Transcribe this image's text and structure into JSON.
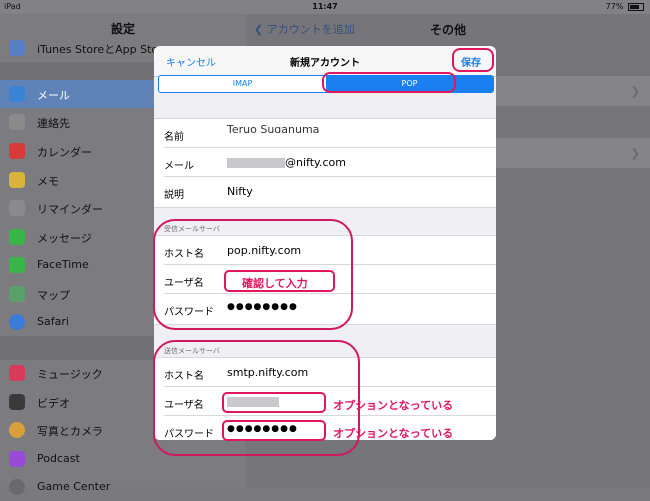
{
  "status_bar": {
    "device": "iPad",
    "time": "11:47",
    "battery": "77%"
  },
  "sidebar": {
    "title": "設定",
    "items_top": [
      {
        "label": "iTunes StoreとApp Store",
        "icon": "itunes-icon",
        "color": "#5a7ec6"
      },
      {
        "label": "メール",
        "icon": "mail-icon",
        "color": "#3a84d8",
        "selected": true
      },
      {
        "label": "連絡先",
        "icon": "contacts-icon",
        "color": "#8a8a8a"
      },
      {
        "label": "カレンダー",
        "icon": "calendar-icon",
        "color": "#d83a3a"
      },
      {
        "label": "メモ",
        "icon": "notes-icon",
        "color": "#d8b53a"
      },
      {
        "label": "リマインダー",
        "icon": "reminders-icon",
        "color": "#8a8a8a"
      },
      {
        "label": "メッセージ",
        "icon": "messages-icon",
        "color": "#3ab54a"
      },
      {
        "label": "FaceTime",
        "icon": "facetime-icon",
        "color": "#3ab54a"
      },
      {
        "label": "マップ",
        "icon": "maps-icon",
        "color": "#5aa06a"
      },
      {
        "label": "Safari",
        "icon": "safari-icon",
        "color": "#3a7ad8"
      }
    ],
    "items_bottom": [
      {
        "label": "ミュージック",
        "icon": "music-icon",
        "color": "#d83a5a"
      },
      {
        "label": "ビデオ",
        "icon": "videos-icon",
        "color": "#3a3a3a"
      },
      {
        "label": "写真とカメラ",
        "icon": "photos-icon",
        "color": "#d8a03a"
      },
      {
        "label": "Podcast",
        "icon": "podcast-icon",
        "color": "#9a4ad8"
      },
      {
        "label": "Game Center",
        "icon": "game-center-icon",
        "color": "#6a6a6a"
      }
    ]
  },
  "detail": {
    "back_label": "アカウントを追加",
    "title": "その他"
  },
  "modal": {
    "cancel_label": "キャンセル",
    "title": "新規アカウント",
    "save_label": "保存",
    "segments": [
      "IMAP",
      "POP"
    ],
    "account_rows": [
      {
        "key": "名前",
        "value": "Teruo Suganuma"
      },
      {
        "key": "メール",
        "value": "@nifty.com"
      },
      {
        "key": "説明",
        "value": "Nifty"
      }
    ],
    "incoming_header": "受信メールサーバ",
    "incoming_rows": [
      {
        "key": "ホスト名",
        "value": "pop.nifty.com"
      },
      {
        "key": "ユーザ名",
        "value": ""
      },
      {
        "key": "パスワード",
        "value": "●●●●●●●●"
      }
    ],
    "outgoing_header": "送信メールサーバ",
    "outgoing_rows": [
      {
        "key": "ホスト名",
        "value": "smtp.nifty.com"
      },
      {
        "key": "ユーザ名",
        "value": ""
      },
      {
        "key": "パスワード",
        "value": "●●●●●●●●"
      }
    ]
  },
  "annotations": {
    "user_note": "確認して入力",
    "optional_note_1": "オプションとなっている",
    "optional_note_2": "オプションとなっている",
    "color": "#e0175f"
  }
}
